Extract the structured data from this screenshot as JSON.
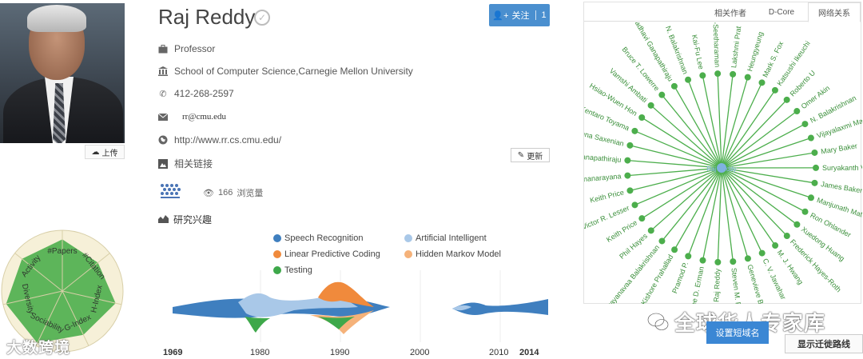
{
  "profile": {
    "name": "Raj Reddy",
    "upload_label": "上传",
    "follow_label": "关注",
    "follow_count": "1",
    "position": "Professor",
    "affiliation": "School of Computer Science,Carnegie Mellon University",
    "phone": "412-268-2597",
    "email": "rr@cmu.edu",
    "homepage": "http://www.rr.cs.cmu.edu/",
    "update_label": "更新",
    "links_label": "相关链接",
    "views_count": "166",
    "views_label": "浏览量",
    "interest_label": "研究兴趣"
  },
  "radar": {
    "axes": [
      "#Papers",
      "#Citation",
      "H-Index",
      "G-Index",
      "Sociability",
      "Diversity",
      "Activity"
    ],
    "values": [
      0.85,
      0.75,
      0.9,
      0.8,
      0.95,
      0.95,
      0.85
    ],
    "fill_color": "#4cae4c"
  },
  "interests": {
    "legend": [
      {
        "label": "Speech Recognition",
        "color": "#3f7fbf"
      },
      {
        "label": "Artificial Intelligent",
        "color": "#a9c8e8"
      },
      {
        "label": "Linear Predictive Coding",
        "color": "#f08a3c"
      },
      {
        "label": "Hidden Markov Model",
        "color": "#f5b27a"
      },
      {
        "label": "Testing",
        "color": "#3ea84a"
      }
    ],
    "axis_ticks": [
      "1969",
      "1980",
      "1990",
      "2000",
      "2010",
      "2014"
    ]
  },
  "network": {
    "tabs": [
      "相关作者",
      "D-Core",
      "网络关系"
    ],
    "active_tab": 2,
    "center_label": "Raj Reddy",
    "node_color": "#4cae4c",
    "nodes": [
      "Lakshmi Prat",
      "Heungyeung",
      "Mark S. Fox",
      "Katsushi Ikeuchi",
      "Roberto U",
      "Omer Akin",
      "N. Balakrishnan",
      "Vijayalaxmi Manoh",
      "Mary Baker",
      "Suryakanth V.",
      "James Baker",
      "Manjunath Mat",
      "Ron Ohlander",
      "Xuedong Huang",
      "Frederick Hayes-Roth",
      "M. J. Hwang",
      "C. V. Jawahar",
      "Genevieve Bell",
      "Steven M. Rubin",
      "Raj Reddy",
      "Lee D. Erman",
      "Pramod P.",
      "Kishore Prahallad",
      "Sarayanavaa Balakrishnan",
      "Phil Hayes",
      "Keith Price",
      "Victor R. Lesser",
      "Keith Price",
      "Yegnanarayana",
      "Ganapathiraju",
      "Anna Saxenian",
      "Kentaro Toyama",
      "Hsiao-Wuen Hon",
      "Vamshi Ambati",
      "Bruce T. Lowerre",
      "Madhavi Ganapathiraju",
      "N. Balakrishnan",
      "Kai-Fu Lee",
      "Judith Klein-Seetharaman"
    ]
  },
  "actions": {
    "short_domain_label": "设置短域名",
    "route_label": "显示迁徙路线"
  },
  "watermarks": {
    "left": "大数跨境",
    "right": "全球华人专家库"
  }
}
